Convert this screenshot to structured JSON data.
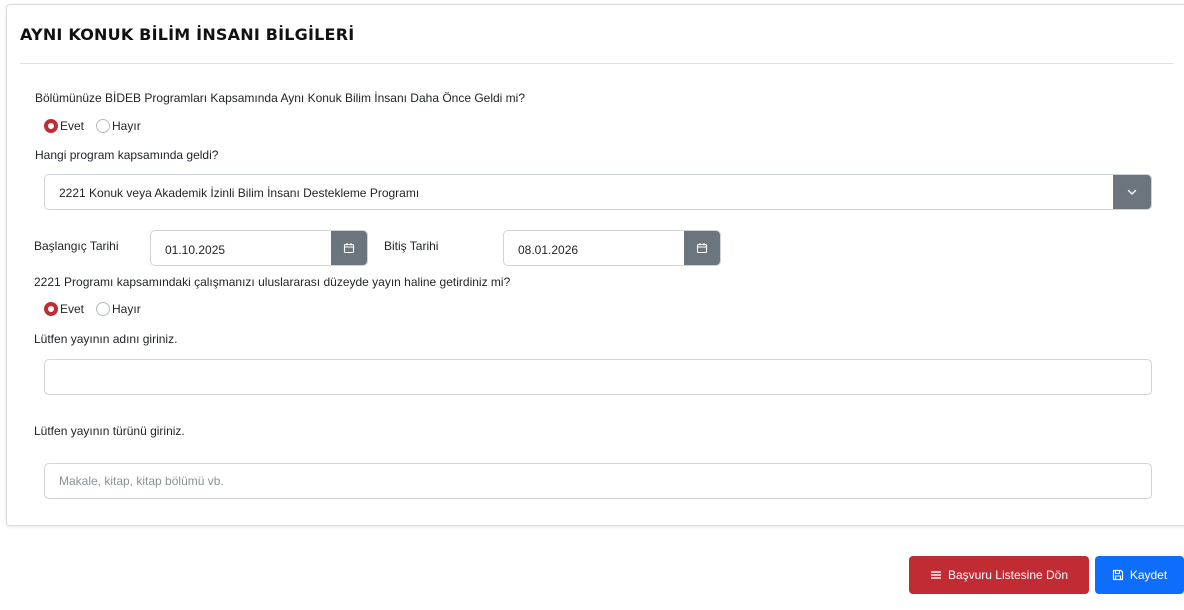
{
  "section": {
    "title": "AYNI KONUK BİLİM İNSANI BİLGİLERİ"
  },
  "q1": {
    "question": "Bölümünüze BİDEB Programları Kapsamında Aynı Konuk Bilim İnsanı Daha Önce Geldi mi?",
    "options": [
      {
        "label": "Evet",
        "checked": true
      },
      {
        "label": "Hayır",
        "checked": false
      }
    ]
  },
  "program": {
    "label": "Hangi program kapsamında geldi?",
    "selected": "2221 Konuk veya Akademik İzinli Bilim İnsanı Destekleme Programı",
    "icon": "chevron-down-icon"
  },
  "dates": {
    "start_label": "Başlangıç Tarihi",
    "start_value": "01.10.2025",
    "end_label": "Bitiş Tarihi",
    "end_value": "08.01.2026",
    "icon": "calendar-icon"
  },
  "q2": {
    "question": "2221 Programı kapsamındaki çalışmanızı uluslararası düzeyde yayın haline getirdiniz mi?",
    "options": [
      {
        "label": "Evet",
        "checked": true
      },
      {
        "label": "Hayır",
        "checked": false
      }
    ]
  },
  "publication_name": {
    "label": "Lütfen yayının adını giriniz.",
    "value": "",
    "placeholder": ""
  },
  "publication_type": {
    "label": "Lütfen yayının türünü giriniz.",
    "value": "",
    "placeholder": "Makale, kitap, kitap bölümü vb."
  },
  "actions": {
    "back_label": "Başvuru Listesine Dön",
    "back_icon": "list-icon",
    "save_label": "Kaydet",
    "save_icon": "save-icon"
  },
  "colors": {
    "danger": "#c12b34",
    "primary": "#0d6efd",
    "addon": "#6c757d"
  }
}
